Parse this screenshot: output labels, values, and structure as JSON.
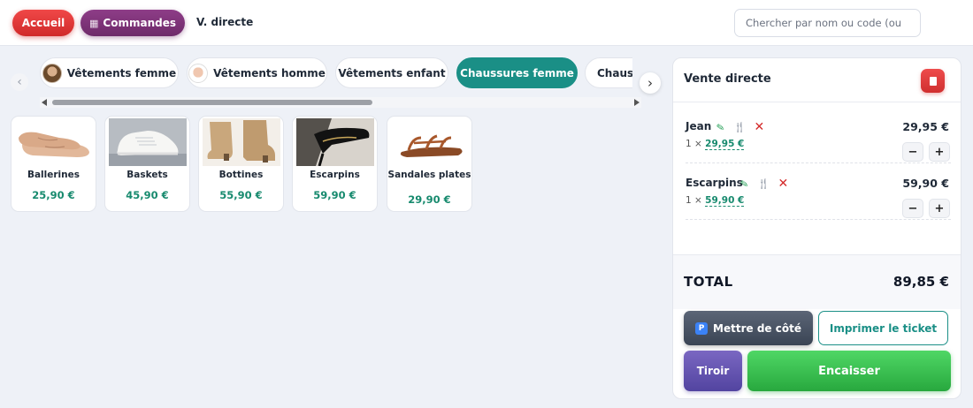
{
  "topbar": {
    "home_label": "Accueil",
    "orders_label": "Commandes",
    "mode_label": "V. directe",
    "search_placeholder": "Chercher par nom ou code (ou"
  },
  "categories": {
    "tabs": [
      {
        "label": "Vêtements femme",
        "active": false
      },
      {
        "label": "Vêtements homme",
        "active": false
      },
      {
        "label": "Vêtements enfant",
        "active": false
      },
      {
        "label": "Chaussures femme",
        "active": true
      },
      {
        "label": "Chauss",
        "active": false
      }
    ],
    "prev_arrow": "‹",
    "next_arrow": "›"
  },
  "products": [
    {
      "name": "Ballerines",
      "price": "25,90 €",
      "image": "ballerina-shoes"
    },
    {
      "name": "Baskets",
      "price": "45,90 €",
      "image": "white-sneakers"
    },
    {
      "name": "Bottines",
      "price": "55,90 €",
      "image": "beige-ankle-boots"
    },
    {
      "name": "Escarpins",
      "price": "59,90 €",
      "image": "black-pumps"
    },
    {
      "name": "Sandales plates",
      "price": "29,90 €",
      "image": "brown-sandals"
    }
  ],
  "sale": {
    "title": "Vente directe",
    "lines": [
      {
        "name": "Jean",
        "qty_prefix": "1 × ",
        "unit_price": "29,95 €",
        "total": "29,95 €"
      },
      {
        "name": "Escarpins",
        "qty_prefix": "1 × ",
        "unit_price": "59,90 €",
        "total": "59,90 €"
      }
    ],
    "stepper_minus": "−",
    "stepper_plus": "+",
    "total_label": "TOTAL",
    "total_value": "89,85 €",
    "hold_label": "Mettre de côté",
    "hold_badge": "P",
    "print_label": "Imprimer le ticket",
    "drawer_label": "Tiroir",
    "checkout_label": "Encaisser"
  },
  "colors": {
    "accent": "#1a8f86",
    "danger": "#d42b2b",
    "success": "#28a83e",
    "price": "#178a6e",
    "orders": "#6e2a6a",
    "drawer": "#5244a0"
  }
}
